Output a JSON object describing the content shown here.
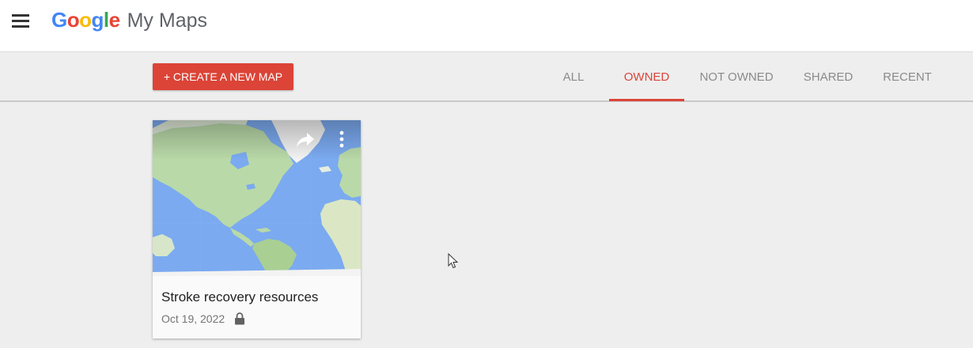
{
  "header": {
    "menu_icon": "hamburger-menu-icon",
    "logo_letters": [
      "G",
      "o",
      "o",
      "g",
      "l",
      "e"
    ],
    "logo_colors": [
      "#4285f4",
      "#ea4335",
      "#fbbc05",
      "#4285f4",
      "#34a853",
      "#ea4335"
    ],
    "product_name": "My Maps"
  },
  "toolbar": {
    "create_label": "+ CREATE A NEW MAP",
    "accent_color": "#db4437",
    "tabs": [
      {
        "label": "ALL",
        "active": false
      },
      {
        "label": "OWNED",
        "active": true
      },
      {
        "label": "NOT OWNED",
        "active": false
      },
      {
        "label": "SHARED",
        "active": false
      },
      {
        "label": "RECENT",
        "active": false
      }
    ]
  },
  "maps": [
    {
      "title": "Stroke recovery resources",
      "date": "Oct 19, 2022",
      "privacy_icon": "lock-icon",
      "share_icon": "share-arrow-icon",
      "more_icon": "more-vert-icon"
    }
  ],
  "colors": {
    "ocean": "#7baaf0",
    "land": "#b9d9a8",
    "ice": "#f3f3f3"
  }
}
